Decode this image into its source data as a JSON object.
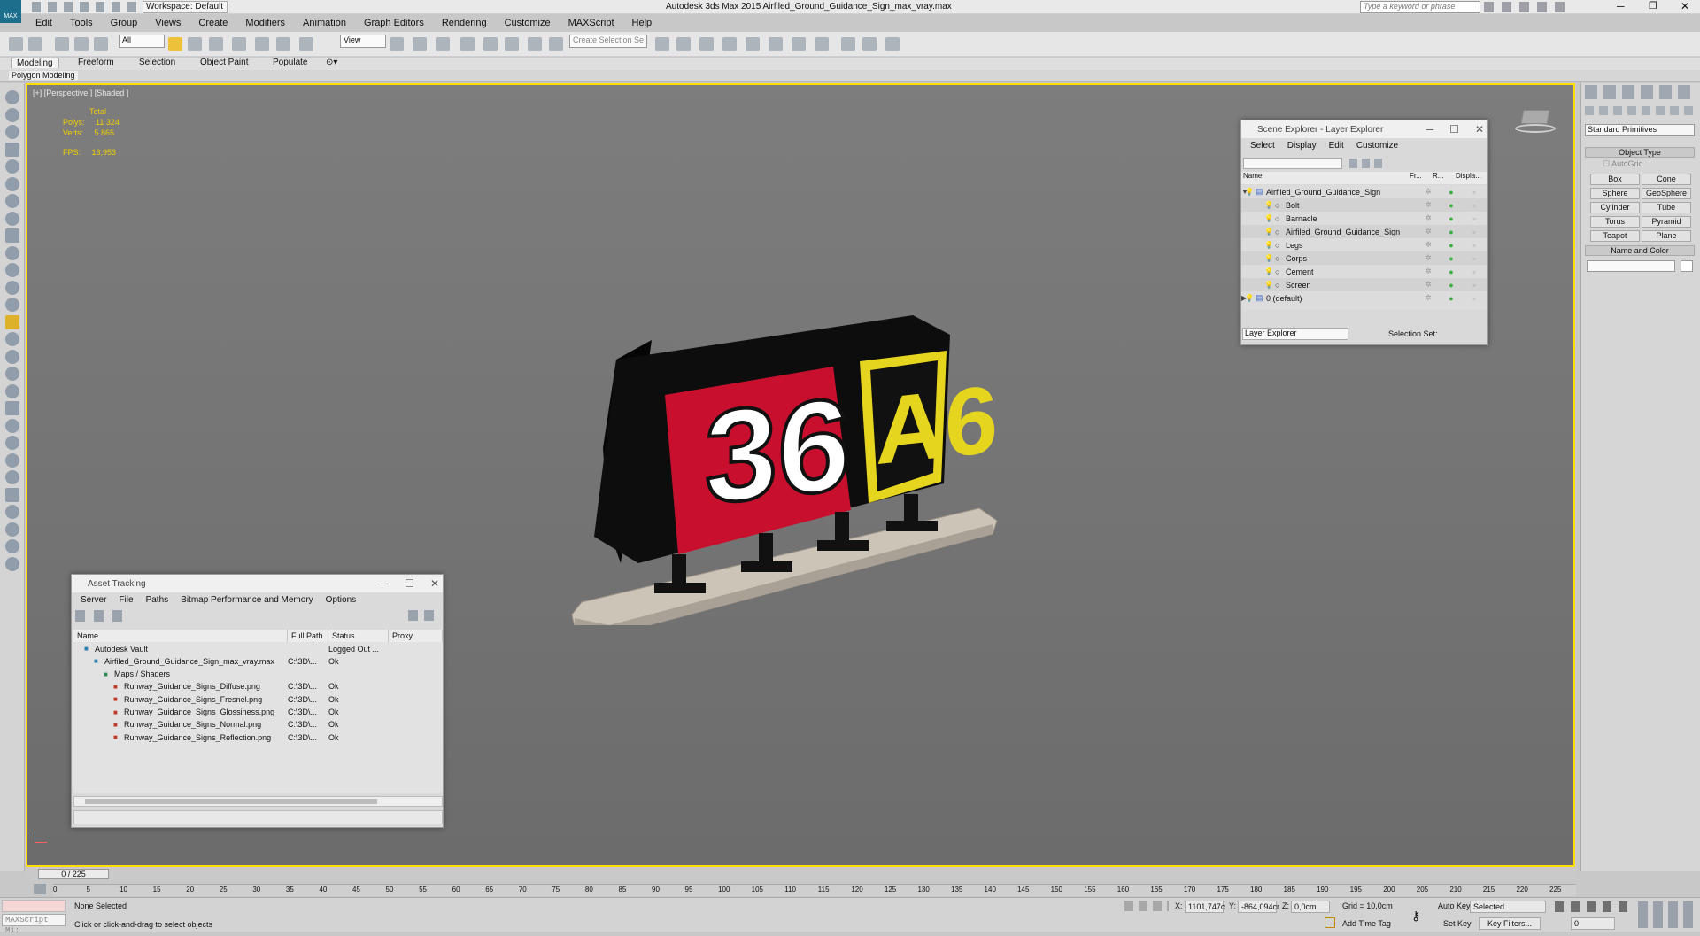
{
  "app": {
    "title": "Autodesk 3ds Max  2015    Airfiled_Ground_Guidance_Sign_max_vray.max",
    "workspace": "Workspace: Default",
    "search_placeholder": "Type a keyword or phrase",
    "logo_text": "MAX"
  },
  "menu": [
    "Edit",
    "Tools",
    "Group",
    "Views",
    "Create",
    "Modifiers",
    "Animation",
    "Graph Editors",
    "Rendering",
    "Customize",
    "MAXScript",
    "Help"
  ],
  "toolbar": {
    "filter": "All",
    "view": "View",
    "selection_set": "Create Selection Se"
  },
  "ribbon": {
    "tabs": [
      "Modeling",
      "Freeform",
      "Selection",
      "Object Paint",
      "Populate"
    ],
    "sub": "Polygon Modeling"
  },
  "viewport": {
    "label": "[+] [Perspective ] [Shaded ]",
    "stats_header": "Total",
    "polys_label": "Polys:",
    "polys": "11 324",
    "verts_label": "Verts:",
    "verts": "5 865",
    "fps_label": "FPS:",
    "fps": "13,953",
    "sign_left": "36",
    "sign_right": "A6",
    "colors": {
      "border": "#ffdd00",
      "red": "#c8102e",
      "yellow": "#e6d51e"
    }
  },
  "scene_explorer": {
    "title": "Scene Explorer - Layer Explorer",
    "menu": [
      "Select",
      "Display",
      "Edit",
      "Customize"
    ],
    "columns": [
      "Name",
      "Fr...",
      "R...",
      "Displa..."
    ],
    "rows": [
      {
        "name": "Airfiled_Ground_Guidance_Sign",
        "level": 0
      },
      {
        "name": "Bolt",
        "level": 1
      },
      {
        "name": "Barnacle",
        "level": 1
      },
      {
        "name": "Airfiled_Ground_Guidance_Sign",
        "level": 1
      },
      {
        "name": "Legs",
        "level": 1
      },
      {
        "name": "Corps",
        "level": 1
      },
      {
        "name": "Cement",
        "level": 1
      },
      {
        "name": "Screen",
        "level": 1
      },
      {
        "name": "0 (default)",
        "level": 0
      }
    ],
    "footer_select": "Layer Explorer",
    "footer_label": "Selection Set:"
  },
  "command_panel": {
    "category": "Standard Primitives",
    "object_type": "Object Type",
    "autogrid": "AutoGrid",
    "buttons": [
      "Box",
      "Cone",
      "Sphere",
      "GeoSphere",
      "Cylinder",
      "Tube",
      "Torus",
      "Pyramid",
      "Teapot",
      "Plane"
    ],
    "name_and_color": "Name and Color"
  },
  "asset_tracking": {
    "title": "Asset Tracking",
    "menu": [
      "Server",
      "File",
      "Paths",
      "Bitmap Performance and Memory",
      "Options"
    ],
    "columns": [
      "Name",
      "Full Path",
      "Status",
      "Proxy Resol..."
    ],
    "rows": [
      {
        "name": "Autodesk Vault",
        "path": "",
        "status": "Logged Out ...",
        "indent": 0
      },
      {
        "name": "Airfiled_Ground_Guidance_Sign_max_vray.max",
        "path": "C:\\3D\\...",
        "status": "Ok",
        "indent": 1
      },
      {
        "name": "Maps / Shaders",
        "path": "",
        "status": "",
        "indent": 2
      },
      {
        "name": "Runway_Guidance_Signs_Diffuse.png",
        "path": "C:\\3D\\...",
        "status": "Ok",
        "indent": 3
      },
      {
        "name": "Runway_Guidance_Signs_Fresnel.png",
        "path": "C:\\3D\\...",
        "status": "Ok",
        "indent": 3
      },
      {
        "name": "Runway_Guidance_Signs_Glossiness.png",
        "path": "C:\\3D\\...",
        "status": "Ok",
        "indent": 3
      },
      {
        "name": "Runway_Guidance_Signs_Normal.png",
        "path": "C:\\3D\\...",
        "status": "Ok",
        "indent": 3
      },
      {
        "name": "Runway_Guidance_Signs_Reflection.png",
        "path": "C:\\3D\\...",
        "status": "Ok",
        "indent": 3
      }
    ]
  },
  "timeline": {
    "frame": "0 / 225",
    "ticks": [
      "0",
      "5",
      "10",
      "15",
      "20",
      "25",
      "30",
      "35",
      "40",
      "45",
      "50",
      "55",
      "60",
      "65",
      "70",
      "75",
      "80",
      "85",
      "90",
      "95",
      "100",
      "105",
      "110",
      "115",
      "120",
      "125",
      "130",
      "135",
      "140",
      "145",
      "150",
      "155",
      "160",
      "165",
      "170",
      "175",
      "180",
      "185",
      "190",
      "195",
      "200",
      "205",
      "210",
      "215",
      "220",
      "225"
    ]
  },
  "status": {
    "maxscript": "MAXScript Mi:",
    "selection": "None Selected",
    "prompt": "Click or click-and-drag to select objects",
    "x_label": "X:",
    "x": "1101,747c",
    "y_label": "Y:",
    "y": "-864,094cr",
    "z_label": "Z:",
    "z": "0,0cm",
    "grid": "Grid = 10,0cm",
    "add_time_tag": "Add Time Tag",
    "auto_key": "Auto Key",
    "set_key": "Set Key",
    "key_mode": "Selected",
    "key_filters": "Key Filters...",
    "frame_field": "0"
  }
}
